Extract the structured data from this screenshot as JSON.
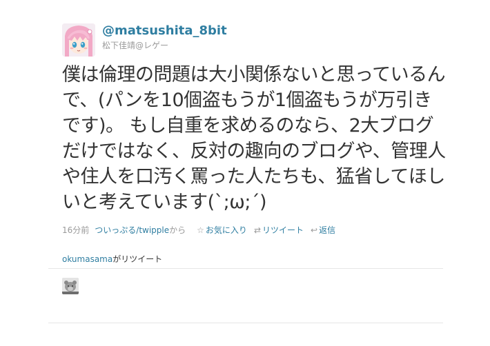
{
  "tweet": {
    "screen_name": "@matsushita_8bit",
    "full_name": "松下佳靖@レゲー",
    "text": "僕は倫理の問題は大小関係ないと思っているんで、(パンを10個盗もうが1個盗もうが万引きです)。 もし自重を求めるのなら、2大ブログだけではなく、反対の趣向のブログや、管理人や住人を口汚く罵った人たちも、猛省してほしいと考えています(`;ω;´)",
    "time": "16分前",
    "source": "ついっぷる/twipple",
    "source_suffix": "から",
    "actions": {
      "favorite": "お気に入り",
      "retweet": "リツイート",
      "reply": "返信"
    },
    "icons": {
      "favorite": "star-icon",
      "retweet": "retweet-icon",
      "reply": "reply-arrow-icon"
    }
  },
  "retweeted_by": {
    "user": "okumasama",
    "suffix": "がリツイート"
  },
  "colors": {
    "link": "#2f7ea1",
    "text": "#333333",
    "muted": "#999999",
    "divider": "#e6e6e6"
  }
}
